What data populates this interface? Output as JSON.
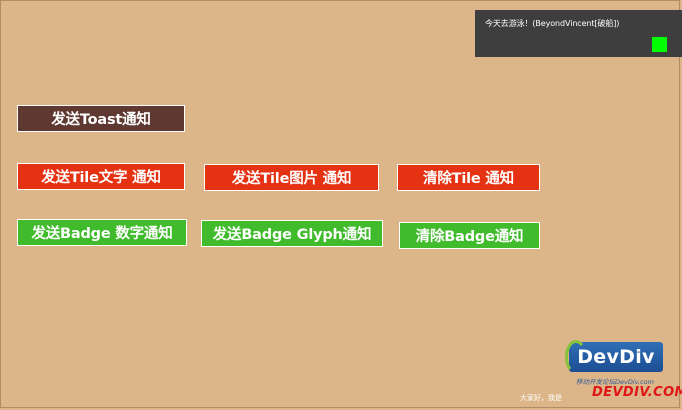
{
  "toast": {
    "message": "今天去游泳！(BeyondVincent[破船])"
  },
  "buttons": {
    "send_toast": "发送Toast通知",
    "send_tile_text": "发送Tile文字 通知",
    "send_tile_image": "发送Tile图片 通知",
    "clear_tile": "清除Tile 通知",
    "send_badge_number": "发送Badge 数字通知",
    "send_badge_glyph": "发送Badge Glyph通知",
    "clear_badge": "清除Badge通知"
  },
  "watermark": {
    "logo": "DevDiv",
    "subtitle": "移动开发论坛DevDiv.com",
    "domain": "DEVDIV.COM",
    "bottom_text": "大家好，我是"
  },
  "colors": {
    "background": "#dcb688",
    "toast_button": "#5e3831",
    "tile_button": "#e53213",
    "badge_button": "#3fbb2b",
    "toast_bg": "#3e3e3e",
    "toast_indicator": "#00ff00"
  }
}
